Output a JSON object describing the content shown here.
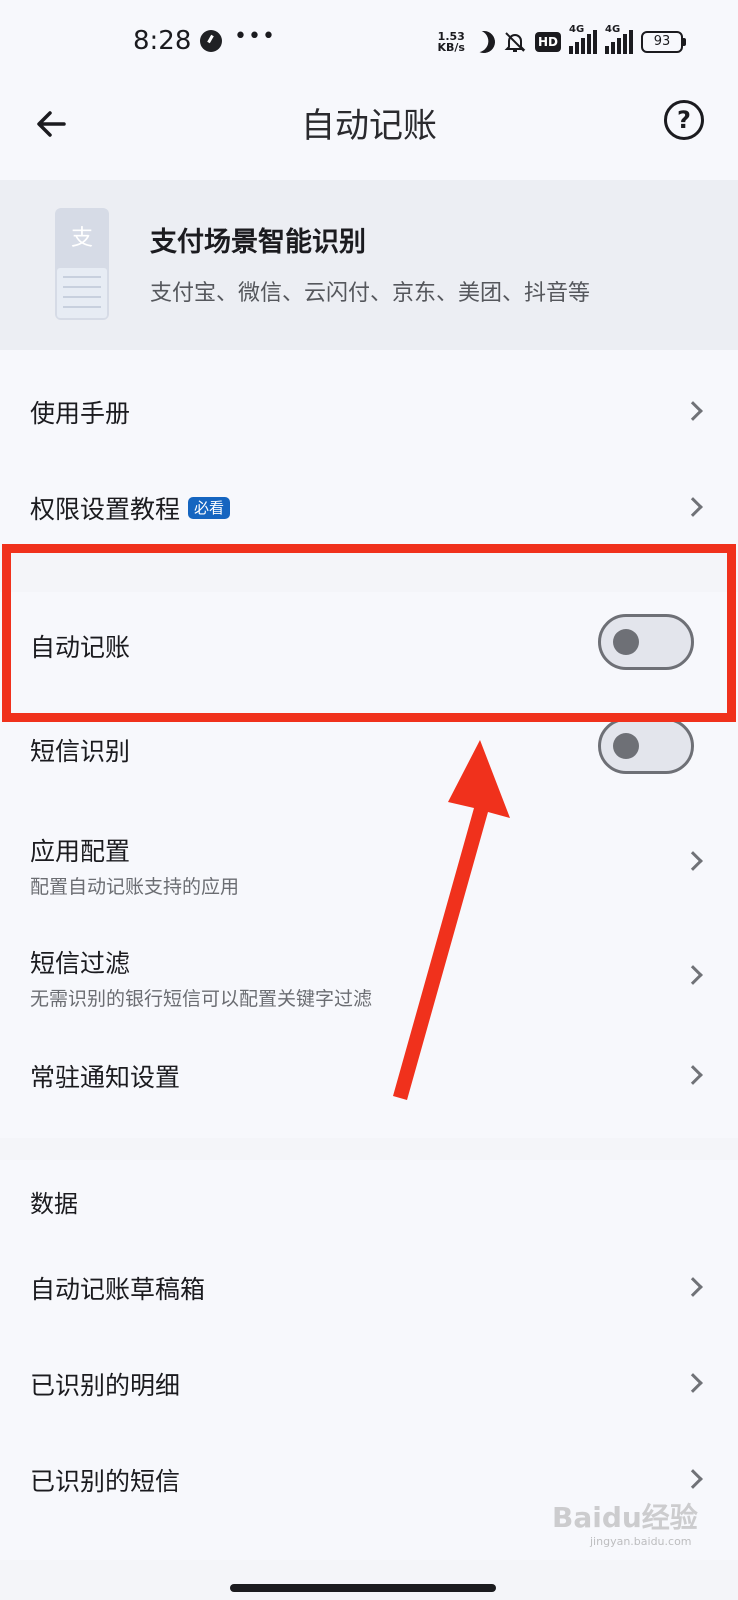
{
  "status_bar": {
    "time": "8:28",
    "more": "•••",
    "net_speed_value": "1.53",
    "net_speed_unit": "KB/s",
    "hd": "HD",
    "net1": "4G",
    "net2": "4G",
    "battery": "93"
  },
  "header": {
    "title": "自动记账",
    "help": "?"
  },
  "banner": {
    "icon_glyph": "支",
    "title": "支付场景智能识别",
    "subtitle": "支付宝、微信、云闪付、京东、美团、抖音等"
  },
  "group1": {
    "manual": "使用手册",
    "permission": "权限设置教程",
    "permission_badge": "必看"
  },
  "group2": {
    "auto_bookkeeping": "自动记账",
    "auto_bookkeeping_on": false,
    "sms_recognition": "短信识别",
    "sms_recognition_on": false,
    "app_config": "应用配置",
    "app_config_sub": "配置自动记账支持的应用",
    "sms_filter": "短信过滤",
    "sms_filter_sub": "无需识别的银行短信可以配置关键字过滤",
    "notification": "常驻通知设置"
  },
  "group3": {
    "title": "数据",
    "drafts": "自动记账草稿箱",
    "recognized_details": "已识别的明细",
    "recognized_sms": "已识别的短信"
  },
  "watermark": {
    "text": "Baidu经验",
    "sub": "jingyan.baidu.com"
  },
  "colors": {
    "highlight": "#f0311c",
    "badge": "#1565c0"
  }
}
